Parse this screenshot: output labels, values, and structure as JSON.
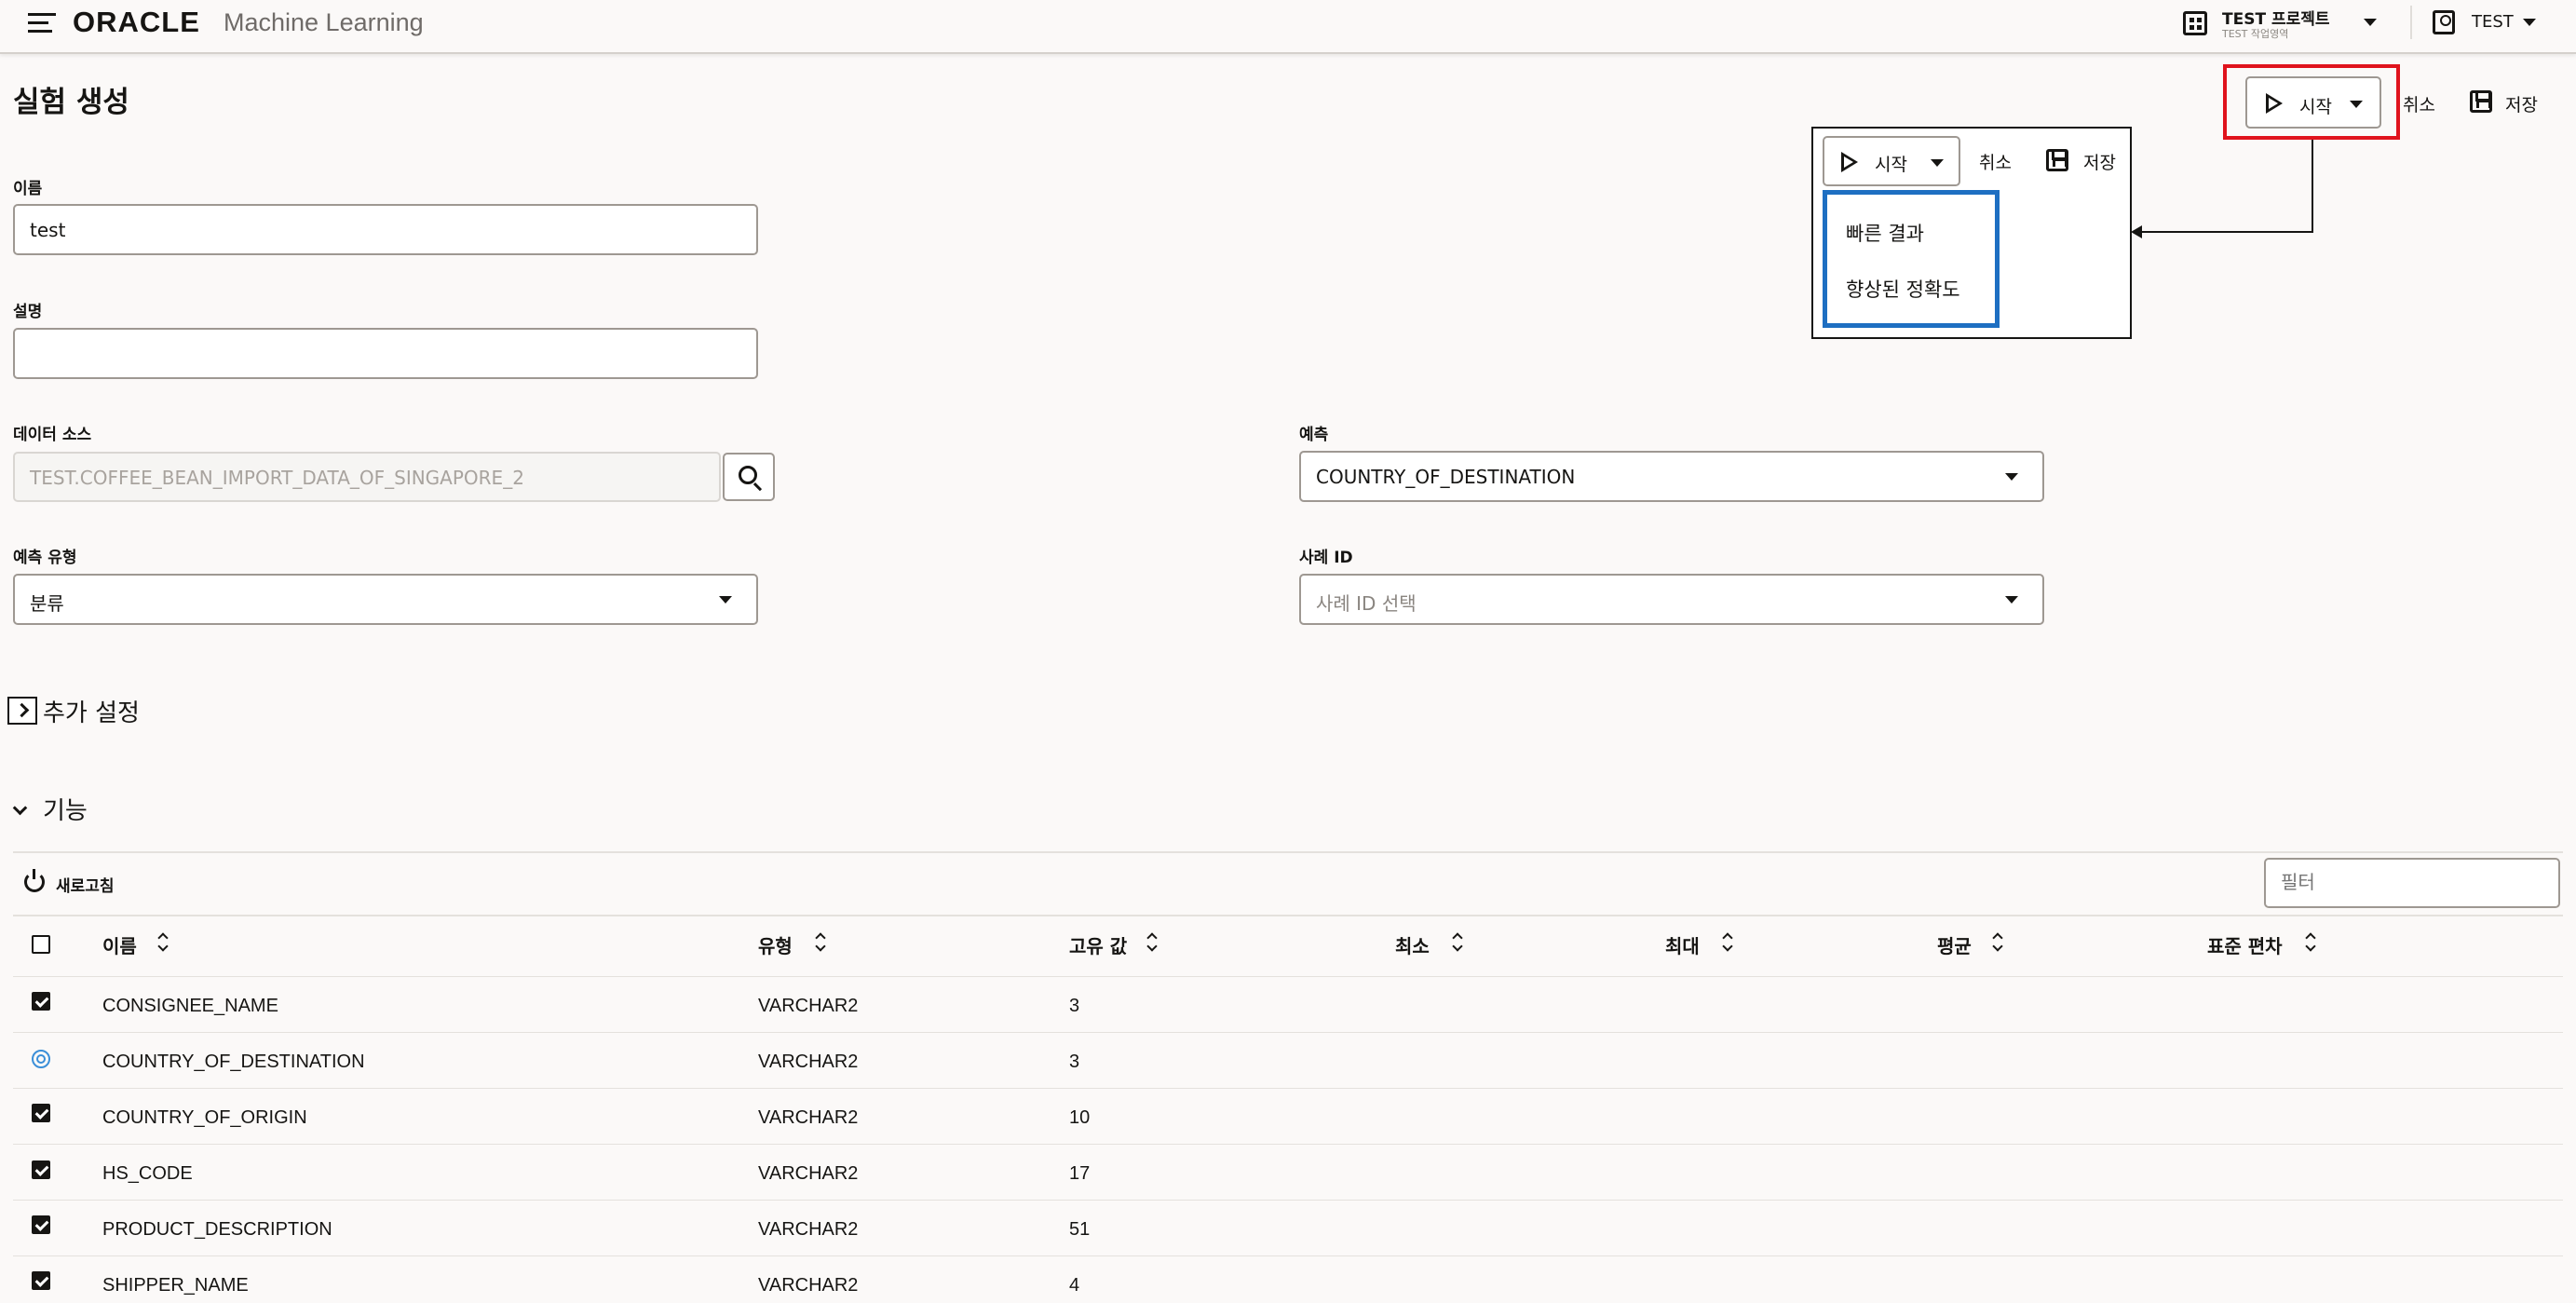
{
  "header": {
    "brand": "ORACLE",
    "brand_sub": "Machine Learning",
    "project_name": "TEST 프로젝트",
    "project_sub": "TEST 작업영역",
    "user": "TEST"
  },
  "page": {
    "title": "실험 생성"
  },
  "toolbar": {
    "start_label": "시작",
    "cancel_label": "취소",
    "save_label": "저장"
  },
  "callout": {
    "start_label": "시작",
    "cancel_label": "취소",
    "save_label": "저장",
    "menu_items": [
      "빠른 결과",
      "향상된 정확도"
    ],
    "highlight_colors": {
      "toolbar": "#e0131c",
      "menu": "#1e6fc2"
    }
  },
  "form": {
    "name_label": "이름",
    "name_value": "test",
    "desc_label": "설명",
    "desc_value": "",
    "datasource_label": "데이터 소스",
    "datasource_value": "TEST.COFFEE_BEAN_IMPORT_DATA_OF_SINGAPORE_2",
    "predict_label": "예측",
    "predict_value": "COUNTRY_OF_DESTINATION",
    "predict_type_label": "예측 유형",
    "predict_type_value": "분류",
    "case_id_label": "사례 ID",
    "case_id_placeholder": "사례 ID 선택"
  },
  "sections": {
    "additional_settings": "추가 설정",
    "features": "기능"
  },
  "features": {
    "refresh_label": "새로고침",
    "filter_placeholder": "필터",
    "columns": [
      "이름",
      "유형",
      "고유 값",
      "최소",
      "최대",
      "평균",
      "표준 편차"
    ],
    "rows": [
      {
        "name": "CONSIGNEE_NAME",
        "type": "VARCHAR2",
        "unique": "3",
        "state": "checked"
      },
      {
        "name": "COUNTRY_OF_DESTINATION",
        "type": "VARCHAR2",
        "unique": "3",
        "state": "target"
      },
      {
        "name": "COUNTRY_OF_ORIGIN",
        "type": "VARCHAR2",
        "unique": "10",
        "state": "checked"
      },
      {
        "name": "HS_CODE",
        "type": "VARCHAR2",
        "unique": "17",
        "state": "checked"
      },
      {
        "name": "PRODUCT_DESCRIPTION",
        "type": "VARCHAR2",
        "unique": "51",
        "state": "checked"
      },
      {
        "name": "SHIPPER_NAME",
        "type": "VARCHAR2",
        "unique": "4",
        "state": "checked"
      }
    ]
  }
}
